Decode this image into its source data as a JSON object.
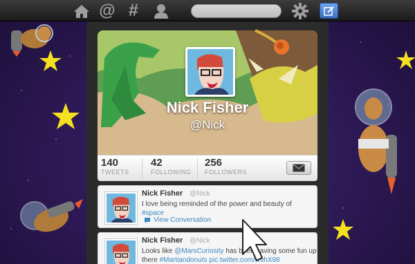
{
  "topbar": {
    "icons": [
      "home-icon",
      "at-icon",
      "hash-icon",
      "person-icon",
      "gear-icon",
      "compose-icon"
    ],
    "at_glyph": "@",
    "hash_glyph": "#",
    "search_placeholder": ""
  },
  "profile": {
    "name": "Nick Fisher",
    "handle": "@Nick",
    "stats": [
      {
        "value": "140",
        "label": "TWEETS"
      },
      {
        "value": "42",
        "label": "FOLLOWING"
      },
      {
        "value": "256",
        "label": "FOLLOWERS"
      }
    ]
  },
  "tweets": [
    {
      "name": "Nick Fisher",
      "handle": "@Nick",
      "text_before": "I love being reminded of the power and beauty of ",
      "hashtag": "#space",
      "action": "View Conversation"
    },
    {
      "name": "Nick Fisher",
      "handle": "@Nick",
      "line1_before": "Looks like ",
      "mention": "@MarsCuriosity",
      "line1_after": " has been having some fun up",
      "line2_before": "there ",
      "hashtag": "#Martiandonuts",
      "link": " pic.twitter.com/",
      "link_tail": "w9hX98"
    }
  ],
  "colors": {
    "accent": "#3b88c3",
    "compose_button": "#4a7fd6",
    "background": "#2f1a58"
  }
}
